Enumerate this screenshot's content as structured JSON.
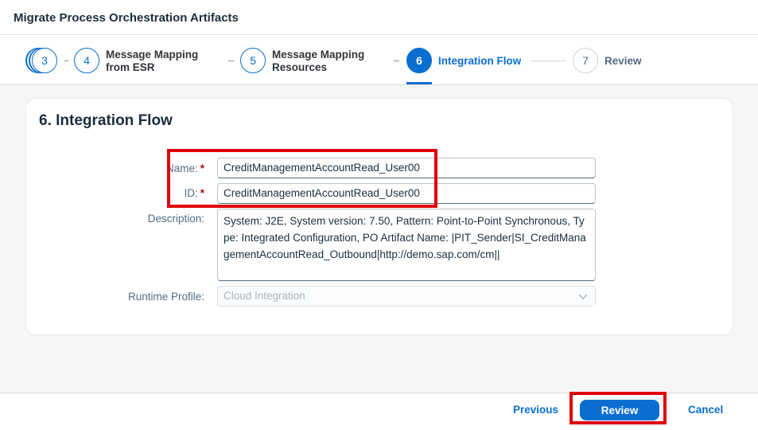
{
  "dialog": {
    "title": "Migrate Process Orchestration Artifacts"
  },
  "wizard": {
    "steps": [
      {
        "number": "3",
        "label": "",
        "state": "completed"
      },
      {
        "number": "4",
        "label_line1": "Message Mapping",
        "label_line2": "from ESR",
        "state": "completed"
      },
      {
        "number": "5",
        "label_line1": "Message Mapping",
        "label_line2": "Resources",
        "state": "completed"
      },
      {
        "number": "6",
        "label": "Integration Flow",
        "state": "active"
      },
      {
        "number": "7",
        "label": "Review",
        "state": "inactive"
      }
    ]
  },
  "section": {
    "title": "6. Integration Flow"
  },
  "form": {
    "name": {
      "label": "Name:",
      "value": "CreditManagementAccountRead_User00",
      "required_mark": "*"
    },
    "id": {
      "label": "ID:",
      "value": "CreditManagementAccountRead_User00",
      "required_mark": "*"
    },
    "description": {
      "label": "Description:",
      "value": "System: J2E, System version: 7.50, Pattern: Point-to-Point Synchronous, Type: Integrated Configuration, PO Artifact Name: |PIT_Sender|SI_CreditManagementAccountRead_Outbound|http://demo.sap.com/cm||"
    },
    "runtime_profile": {
      "label": "Runtime Profile:",
      "value": "Cloud Integration",
      "icon": "chevron-down-icon"
    }
  },
  "footer": {
    "previous_label": "Previous",
    "review_label": "Review",
    "cancel_label": "Cancel"
  },
  "colors": {
    "accent": "#0a6ed1",
    "highlight": "#e0000c",
    "required": "#aa0808"
  }
}
